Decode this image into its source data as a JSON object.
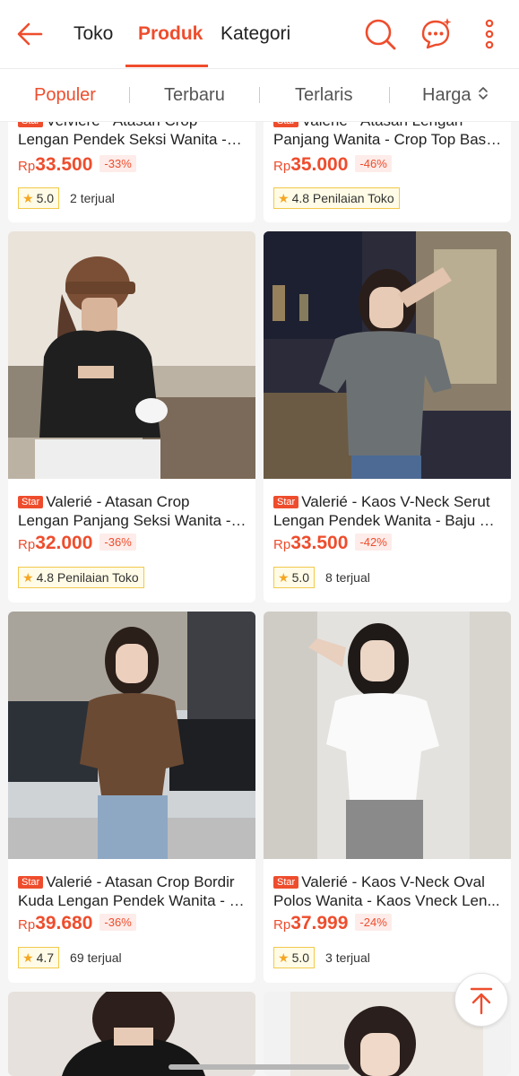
{
  "header": {
    "tabs": [
      {
        "label": "Toko"
      },
      {
        "label": "Produk"
      },
      {
        "label": "Kategori"
      }
    ]
  },
  "sort": {
    "items": [
      {
        "label": "Populer"
      },
      {
        "label": "Terbaru"
      },
      {
        "label": "Terlaris"
      },
      {
        "label": "Harga"
      }
    ]
  },
  "colors": {
    "accent": "#ee4d2d"
  },
  "products": [
    {
      "badge": "Star",
      "title_line1": "Velviere - Atasan Crop",
      "title_line2": "Lengan Pendek Seksi Wanita -C...",
      "currency": "Rp",
      "price": "33.500",
      "discount": "-33%",
      "rating": "5.0",
      "sold": "2 terjual"
    },
    {
      "badge": "Star",
      "title_line1": "Valerie - Atasan Lengan",
      "title_line2": "Panjang Wanita - Crop Top Basi...",
      "currency": "Rp",
      "price": "35.000",
      "discount": "-46%",
      "rating": "4.8 Penilaian Toko",
      "sold": ""
    },
    {
      "badge": "Star",
      "title_line1": "Valerié - Atasan Crop",
      "title_line2": "Lengan Panjang Seksi Wanita - ...",
      "currency": "Rp",
      "price": "32.000",
      "discount": "-36%",
      "rating": "4.8 Penilaian Toko",
      "sold": ""
    },
    {
      "badge": "Star",
      "title_line1": "Valerié - Kaos V-Neck Serut",
      "title_line2": "Lengan Pendek Wanita - Baju T-...",
      "currency": "Rp",
      "price": "33.500",
      "discount": "-42%",
      "rating": "5.0",
      "sold": "8 terjual"
    },
    {
      "badge": "Star",
      "title_line1": "Valerié  - Atasan Crop Bordir",
      "title_line2": "Kuda Lengan Pendek Wanita - K...",
      "currency": "Rp",
      "price": "39.680",
      "discount": "-36%",
      "rating": "4.7",
      "sold": "69 terjual"
    },
    {
      "badge": "Star",
      "title_line1": "Valerié - Kaos V-Neck Oval",
      "title_line2": "Polos Wanita - Kaos Vneck Len...",
      "currency": "Rp",
      "price": "37.999",
      "discount": "-24%",
      "rating": "5.0",
      "sold": "3 terjual"
    }
  ]
}
